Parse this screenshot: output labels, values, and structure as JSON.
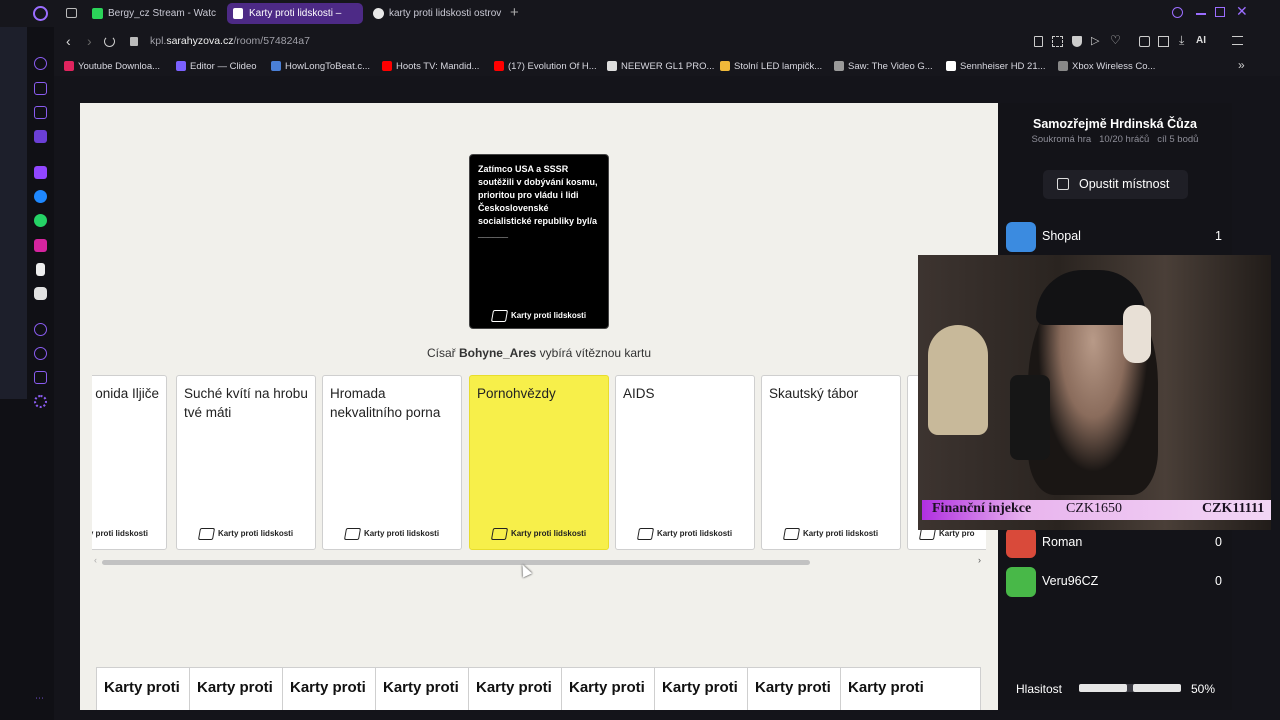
{
  "tabs": [
    {
      "label": "Bergy_cz Stream - Watch L",
      "color": "#2bd459"
    },
    {
      "label": "Karty proti lidskosti –",
      "color": "#ffffff",
      "active": true
    },
    {
      "label": "karty proti lidskosti ostrov",
      "color": "#e8e8e8"
    }
  ],
  "address": {
    "url_prefix": "kpl.",
    "url_host": "sarahyzova.cz",
    "url_path": "/room/574824a7"
  },
  "toolbar": {
    "ai_label": "AI"
  },
  "bookmarks": [
    {
      "label": "Youtube Downloa...",
      "color": "#e0245e"
    },
    {
      "label": "Editor — Clideo",
      "color": "#7b61ff"
    },
    {
      "label": "HowLongToBeat.c...",
      "color": "#4a7fd6"
    },
    {
      "label": "Hoots TV: Mandid...",
      "color": "#ff0000"
    },
    {
      "label": "(17) Evolution Of H...",
      "color": "#ff0000"
    },
    {
      "label": "NEEWER GL1 PRO...",
      "color": "#dddddd"
    },
    {
      "label": "Stolní LED lampičk...",
      "color": "#f0b93a"
    },
    {
      "label": "Saw: The Video G...",
      "color": "#999999"
    },
    {
      "label": "Sennheiser HD 21...",
      "color": "#ffffff"
    },
    {
      "label": "Xbox Wireless Co...",
      "color": "#888888"
    }
  ],
  "game": {
    "black_card_text": "Zatímco USA a SSSR soutěžili v dobývání kosmu, prioritou pro vládu i lidi Československé socialistické republiky byl/a ______",
    "card_brand": "Karty proti lidskosti",
    "status_prefix": "Císař",
    "status_name": "Bohyne_Ares",
    "status_suffix": "vybírá vítěznou kartu",
    "white_cards": [
      "onida Iljiče",
      "Suché kvítí na hrobu tvé máti",
      "Hromada nekvalitního porna",
      "Pornohvězdy",
      "AIDS",
      "Skautský tábor"
    ],
    "partial_brand": "Karty pro",
    "bottom_cards": [
      "Karty proti",
      "Karty proti",
      "Karty proti",
      "Karty proti",
      "Karty proti",
      "Karty proti",
      "Karty proti",
      "Karty proti",
      "Karty proti"
    ]
  },
  "panel": {
    "room_title": "Samozřejmě Hrdinská Čůza",
    "room_private": "Soukromá hra",
    "room_players": "10/20 hráčů",
    "room_goal": "cíl 5 bodů",
    "leave_label": "Opustit místnost",
    "players": [
      {
        "name": "Shopal",
        "score": "1",
        "color": "#3b8be0"
      },
      {
        "name": "Roman",
        "score": "0",
        "color": "#d94a3a"
      },
      {
        "name": "Veru96CZ",
        "score": "0",
        "color": "#48b848"
      }
    ],
    "volume_label": "Hlasitost",
    "volume_value": "50%",
    "volume_level": 0.5
  },
  "overlay": {
    "title": "Finanční injekce",
    "amount_1": "CZK1650",
    "amount_2": "CZK11111"
  }
}
